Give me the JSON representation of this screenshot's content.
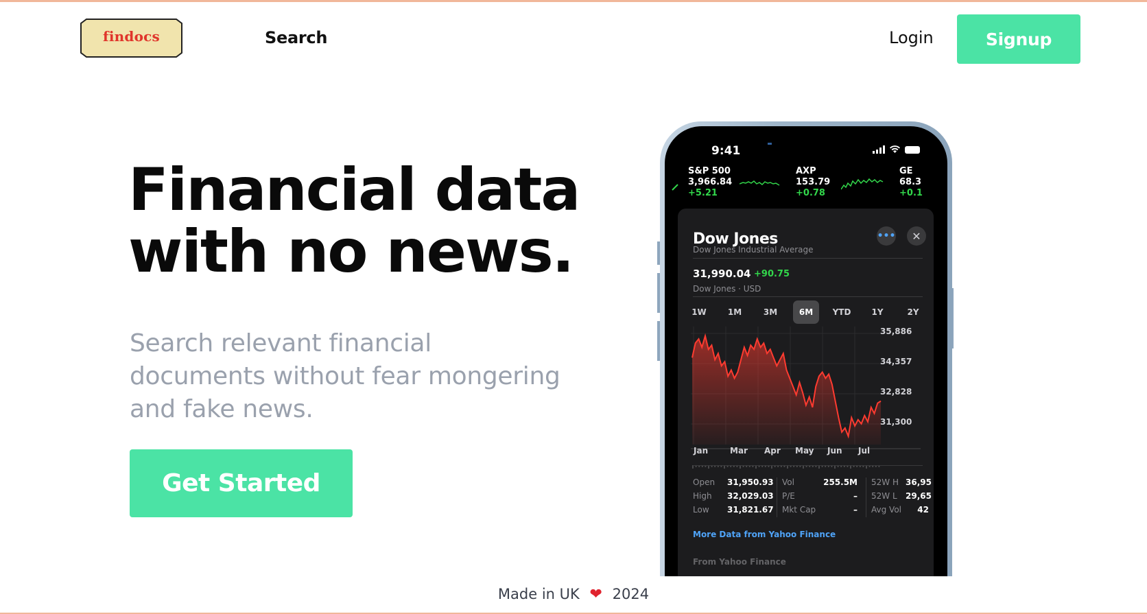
{
  "header": {
    "logo_text": "findocs",
    "nav_search": "Search",
    "login": "Login",
    "signup": "Signup"
  },
  "hero": {
    "title_line1": "Financial data",
    "title_line2": "with no news.",
    "subtitle_line1": "Search relevant financial",
    "subtitle_line2": "documents without fear mongering",
    "subtitle_line3": "and fake news.",
    "cta": "Get Started"
  },
  "footer": {
    "made_in": "Made in UK",
    "year": "2024"
  },
  "colors": {
    "accent": "#4be3a5",
    "rule": "#f1b79a",
    "logo_bg": "#f1e4ad",
    "logo_text": "#e0352b",
    "subtitle": "#9aa1ad",
    "stock_up": "#32d74b",
    "stock_down": "#ff3b30"
  },
  "phone": {
    "status_time": "9:41",
    "tickers": [
      {
        "symbol": "S&P 500",
        "price": "3,966.84",
        "change": "+5.21"
      },
      {
        "symbol": "AXP",
        "price": "153.79",
        "change": "+0.78"
      },
      {
        "symbol": "GE",
        "price": "68.3",
        "change": "+0.1"
      }
    ],
    "card": {
      "title": "Dow Jones",
      "subtitle": "Dow Jones Industrial Average",
      "more_icon": "•••",
      "close_icon": "✕",
      "price": "31,990.04",
      "change": "+90.75",
      "price_sub": "Dow Jones · USD",
      "ranges": [
        "1W",
        "1M",
        "3M",
        "6M",
        "YTD",
        "1Y",
        "2Y"
      ],
      "active_range": "6M",
      "stats": {
        "col1": [
          [
            "Open",
            "31,950.93"
          ],
          [
            "High",
            "32,029.03"
          ],
          [
            "Low",
            "31,821.67"
          ]
        ],
        "col2": [
          [
            "Vol",
            "255.5M"
          ],
          [
            "P/E",
            "–"
          ],
          [
            "Mkt Cap",
            "–"
          ]
        ],
        "col3": [
          [
            "52W H",
            "36,95"
          ],
          [
            "52W L",
            "29,65"
          ],
          [
            "Avg Vol",
            "42"
          ]
        ]
      },
      "link": "More Data from Yahoo Finance",
      "news_header": "From Yahoo Finance"
    }
  },
  "chart_data": {
    "type": "area",
    "title": "",
    "x": [
      "Jan",
      "Mar",
      "Apr",
      "May",
      "Jun",
      "Jul"
    ],
    "y_ticks": [
      "35,886",
      "34,357",
      "32,828",
      "31,300"
    ],
    "ylim": [
      30500,
      36200
    ],
    "series": [
      {
        "values": [
          34700,
          35400,
          35600,
          35200,
          35750,
          35100,
          35300,
          34600,
          34900,
          34300,
          34500,
          33800,
          34100,
          33700,
          34000,
          34600,
          35200,
          34800,
          35300,
          35100,
          35600,
          35200,
          35400,
          34900,
          35100,
          34700,
          34300,
          34600,
          34900,
          34100,
          33700,
          33300,
          32900,
          33500,
          33000,
          32400,
          32800,
          32300,
          33300,
          33800,
          34000,
          33700,
          33900,
          33400,
          32600,
          31800,
          31100,
          31300,
          30900,
          31800,
          31400,
          31700,
          31500,
          31900,
          31600,
          32300,
          32000,
          32500,
          32600
        ]
      }
    ],
    "grid": true
  }
}
